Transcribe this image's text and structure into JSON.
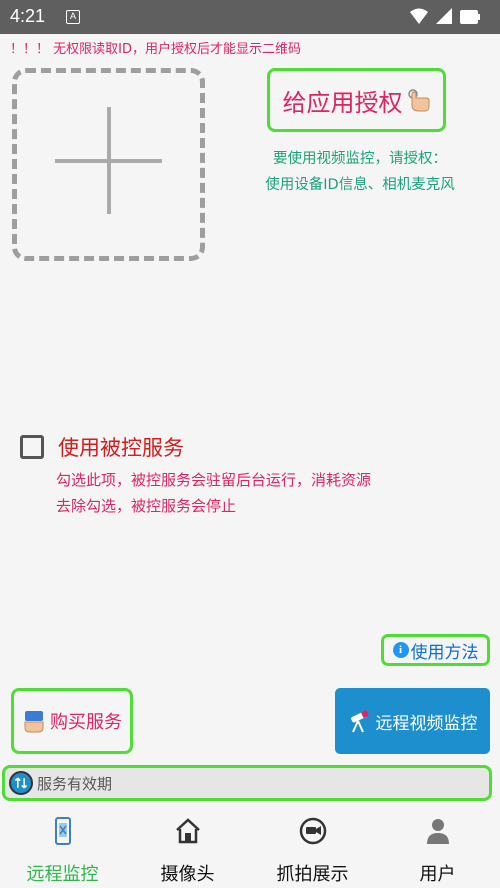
{
  "status_bar": {
    "time": "4:21",
    "notification_glyph": "A",
    "icons": [
      "wifi-icon",
      "signal-icon",
      "battery-icon"
    ]
  },
  "warning_text": "！！！ 无权限读取ID，用户授权后才能显示二维码",
  "qr_placeholder": {
    "icon": "plus-icon"
  },
  "auth_button": {
    "label": "给应用授权",
    "icon": "pointing-hand-icon"
  },
  "auth_info": {
    "line1": "要使用视频监控，请授权：",
    "line2": "使用设备ID信息、相机麦克风"
  },
  "controlled_service": {
    "checked": false,
    "label": "使用被控服务",
    "desc_line1": "勾选此项，被控服务会驻留后台运行，消耗资源",
    "desc_line2": "去除勾选，被控服务会停止"
  },
  "howto_button": {
    "label": "使用方法",
    "icon": "info-icon"
  },
  "buy_button": {
    "label": "购买服务",
    "icon": "purchase-hand-icon"
  },
  "remote_video_button": {
    "label": "远程视频监控",
    "icon": "telescope-icon"
  },
  "validity_field": {
    "placeholder": "服务有效期",
    "icon": "validity-icon"
  },
  "bottom_nav": {
    "items": [
      {
        "label": "远程监控",
        "icon": "phone-scan-icon",
        "active": true
      },
      {
        "label": "摄像头",
        "icon": "home-icon",
        "active": false
      },
      {
        "label": "抓拍展示",
        "icon": "camera-icon",
        "active": false
      },
      {
        "label": "用户",
        "icon": "user-icon",
        "active": false
      }
    ]
  },
  "colors": {
    "accent_green": "#4cde33",
    "warning_pink": "#e0245e",
    "info_teal": "#1aa37a",
    "button_blue": "#1d8fcf",
    "active_nav": "#2db84a"
  }
}
